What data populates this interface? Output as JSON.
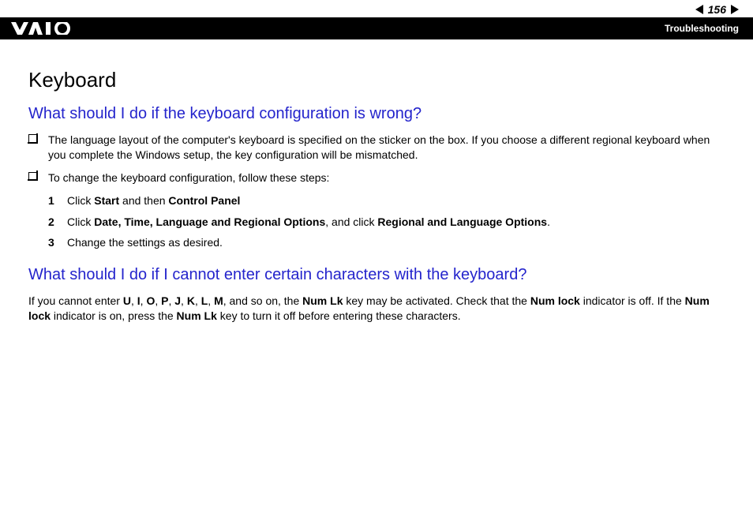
{
  "header": {
    "page_number": "156",
    "breadcrumb": "Troubleshooting",
    "logo_alt": "VAIO"
  },
  "content": {
    "section_title": "Keyboard",
    "q1": {
      "question": "What should I do if the keyboard configuration is wrong?",
      "bullet1": "The language layout of the computer's keyboard is specified on the sticker on the box. If you choose a different regional keyboard when you complete the Windows setup, the key configuration will be mismatched.",
      "bullet2": "To change the keyboard configuration, follow these steps:",
      "steps": {
        "s1": {
          "num": "1",
          "pre": "Click ",
          "b1": "Start",
          "mid": " and then ",
          "b2": "Control Panel"
        },
        "s2": {
          "num": "2",
          "pre": "Click ",
          "b1": "Date, Time, Language and Regional Options",
          "mid": ", and click ",
          "b2": "Regional and Language Options",
          "post": "."
        },
        "s3": {
          "num": "3",
          "text": "Change the settings as desired."
        }
      }
    },
    "q2": {
      "question": "What should I do if I cannot enter certain characters with the keyboard?",
      "p1_pre": "If you cannot enter ",
      "chars": [
        "U",
        "I",
        "O",
        "P",
        "J",
        "K",
        "L",
        "M"
      ],
      "p1_mid1": ", and so on, the ",
      "numlk1": "Num Lk",
      "p1_mid2": " key may be activated. Check that the ",
      "numlock1": "Num lock",
      "p1_mid3": " indicator is off. If the ",
      "numlock2": "Num lock",
      "p1_mid4": " indicator is on, press the ",
      "numlk2": "Num Lk",
      "p1_end": " key to turn it off before entering these characters."
    }
  }
}
